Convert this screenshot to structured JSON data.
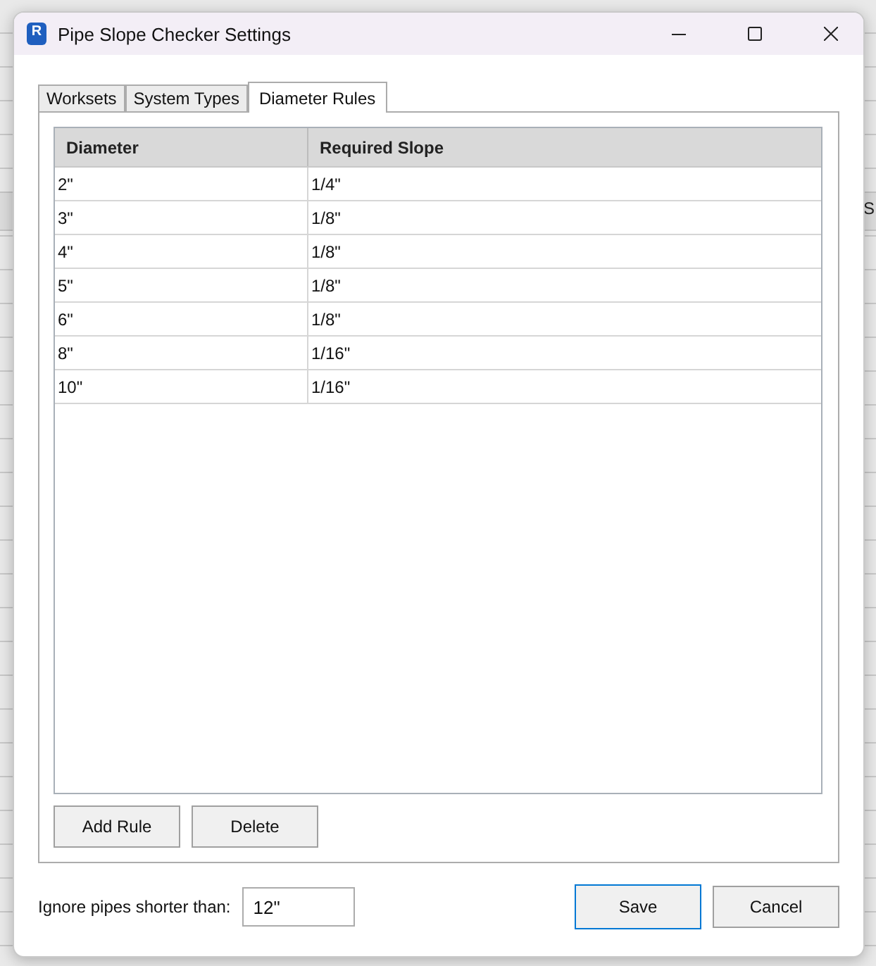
{
  "window": {
    "title": "Pipe Slope Checker Settings",
    "icon_text": "R"
  },
  "background": {
    "column_header": "S"
  },
  "tabs": [
    {
      "label": "Worksets",
      "selected": false
    },
    {
      "label": "System Types",
      "selected": false
    },
    {
      "label": "Diameter Rules",
      "selected": true
    }
  ],
  "table": {
    "columns": [
      "Diameter",
      "Required Slope"
    ],
    "rows": [
      [
        "2\"",
        "1/4\""
      ],
      [
        "3\"",
        "1/8\""
      ],
      [
        "4\"",
        "1/8\""
      ],
      [
        "5\"",
        "1/8\""
      ],
      [
        "6\"",
        "1/8\""
      ],
      [
        "8\"",
        "1/16\""
      ],
      [
        "10\"",
        "1/16\""
      ]
    ]
  },
  "table_buttons": [
    "Add Rule",
    "Delete"
  ],
  "min_length": {
    "label": "Ignore pipes shorter than:",
    "value": "12\""
  },
  "buttons": [
    {
      "label": "Save",
      "default": true
    },
    {
      "label": "Cancel",
      "default": false
    }
  ]
}
